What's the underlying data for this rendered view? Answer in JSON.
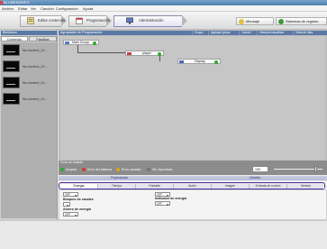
{
  "window": {
    "title": "BLUMEN2INFO"
  },
  "menu": [
    "Archivo",
    "Editar",
    "Ver",
    "Canción",
    "Configuración",
    "Ayuda"
  ],
  "toolbar": {
    "steps": [
      {
        "label": "Editor contenido"
      },
      {
        "label": "Programación"
      },
      {
        "label": "Administración"
      }
    ],
    "right_buttons": [
      {
        "label": "Mensaje"
      },
      {
        "label": "Sistemas de registro"
      }
    ]
  },
  "sidebar": {
    "title": "Biblioteca",
    "tabs": [
      "Contenido",
      "Plantillas"
    ],
    "items": [
      {
        "caption": "file:/content_20..."
      },
      {
        "caption": "file:/content_20..."
      },
      {
        "caption": "file:/content_20..."
      },
      {
        "caption": "file:/content_20..."
      }
    ]
  },
  "workspace": {
    "title": "Agrupación de Programación",
    "tools": [
      "Grupo",
      "Agregar grupo",
      "Cancel",
      "Vista previsualizar",
      "Vista de lista"
    ],
    "nodes": [
      {
        "label": "Main Group",
        "status": "green"
      },
      {
        "label": "player",
        "status": "green"
      },
      {
        "label": "Display",
        "status": "green"
      }
    ]
  },
  "state": {
    "title": "Guía de estado",
    "legend": [
      {
        "label": "Aceptar",
        "color": "#2fa82f"
      },
      {
        "label": "Error del sistema",
        "color": "#d43a2a"
      },
      {
        "label": "Error canales",
        "color": "#e0a020"
      },
      {
        "label": "Sin reproducir",
        "color": "#777777"
      }
    ],
    "zoom": {
      "value": "100",
      "level": 0.88
    }
  },
  "properties": {
    "left_title": "Propiedades",
    "right_title": "Detalles",
    "tabs": [
      "Energía",
      "Tiempo",
      "Pantalla",
      "Audio",
      "Imagen",
      "Entrada de control",
      "Versión"
    ],
    "fields": [
      {
        "value": "OFF"
      },
      {
        "label": "Bloqueo de canales",
        "value": ""
      },
      {
        "label": "Ahorro de energía",
        "value": "OFF"
      },
      {
        "value": "OFF"
      },
      {
        "label": "Indicador de energía",
        "value": "OFF"
      }
    ]
  }
}
